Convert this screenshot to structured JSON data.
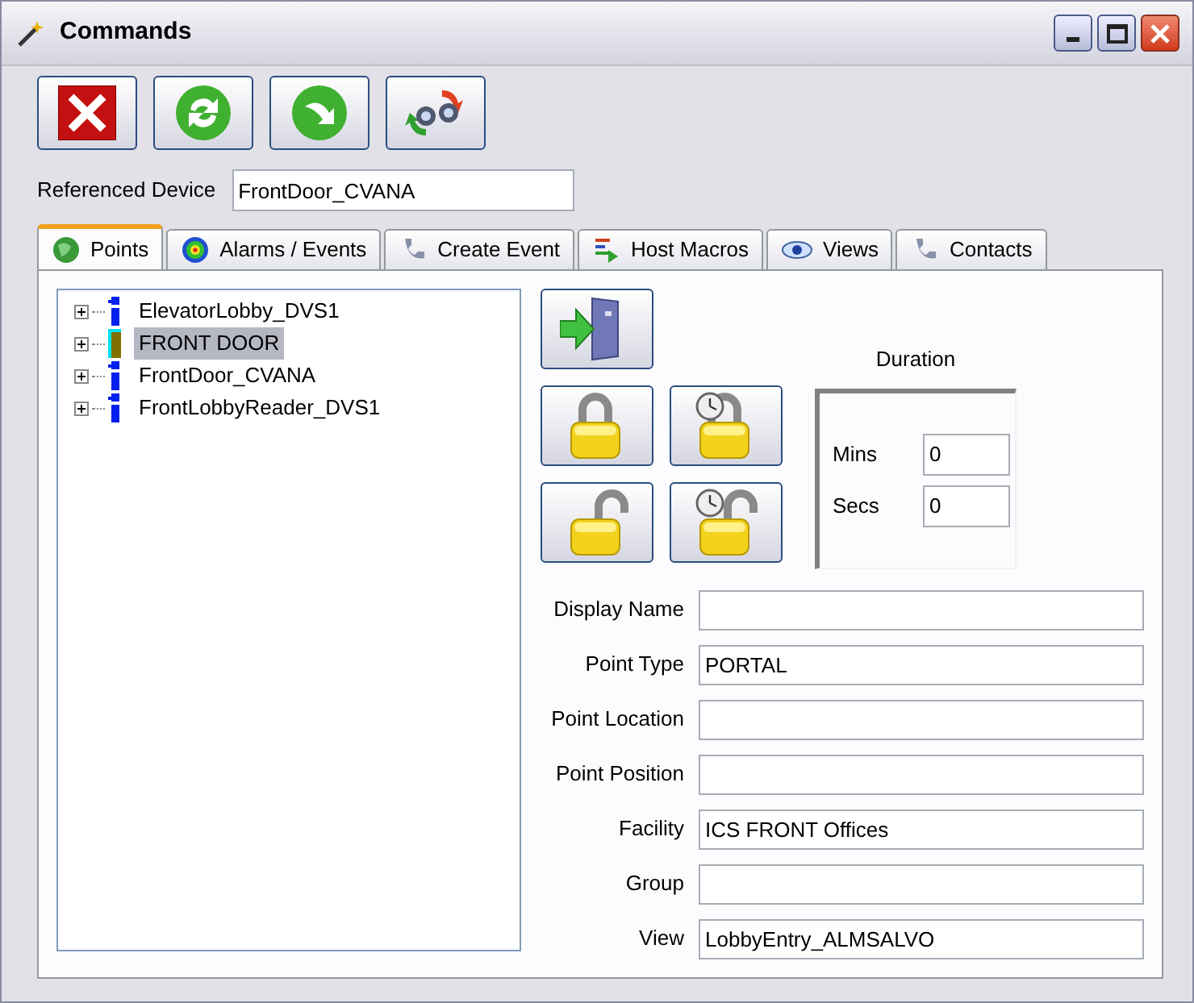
{
  "window": {
    "title": "Commands"
  },
  "referenced_device": {
    "label": "Referenced Device",
    "value": "FrontDoor_CVANA"
  },
  "tabs": [
    {
      "label": "Points",
      "selected": true
    },
    {
      "label": "Alarms / Events",
      "selected": false
    },
    {
      "label": "Create Event",
      "selected": false
    },
    {
      "label": "Host Macros",
      "selected": false
    },
    {
      "label": "Views",
      "selected": false
    },
    {
      "label": "Contacts",
      "selected": false
    }
  ],
  "tree": [
    {
      "label": "ElevatorLobby_DVS1",
      "kind": "reader",
      "selected": false
    },
    {
      "label": "FRONT DOOR",
      "kind": "door",
      "selected": true
    },
    {
      "label": "FrontDoor_CVANA",
      "kind": "reader",
      "selected": false
    },
    {
      "label": "FrontLobbyReader_DVS1",
      "kind": "reader",
      "selected": false
    }
  ],
  "duration": {
    "title": "Duration",
    "fields": [
      {
        "label": "Mins",
        "value": "0"
      },
      {
        "label": "Secs",
        "value": "0"
      }
    ]
  },
  "properties": [
    {
      "label": "Display Name"
    },
    {
      "label": "Point Type",
      "value": "PORTAL"
    },
    {
      "label": "Point Location"
    },
    {
      "label": "Point Position"
    },
    {
      "label": "Facility",
      "value": "ICS FRONT Offices"
    },
    {
      "label": "Group"
    },
    {
      "label": "View",
      "value": "LobbyEntry_ALMSALVO"
    }
  ]
}
